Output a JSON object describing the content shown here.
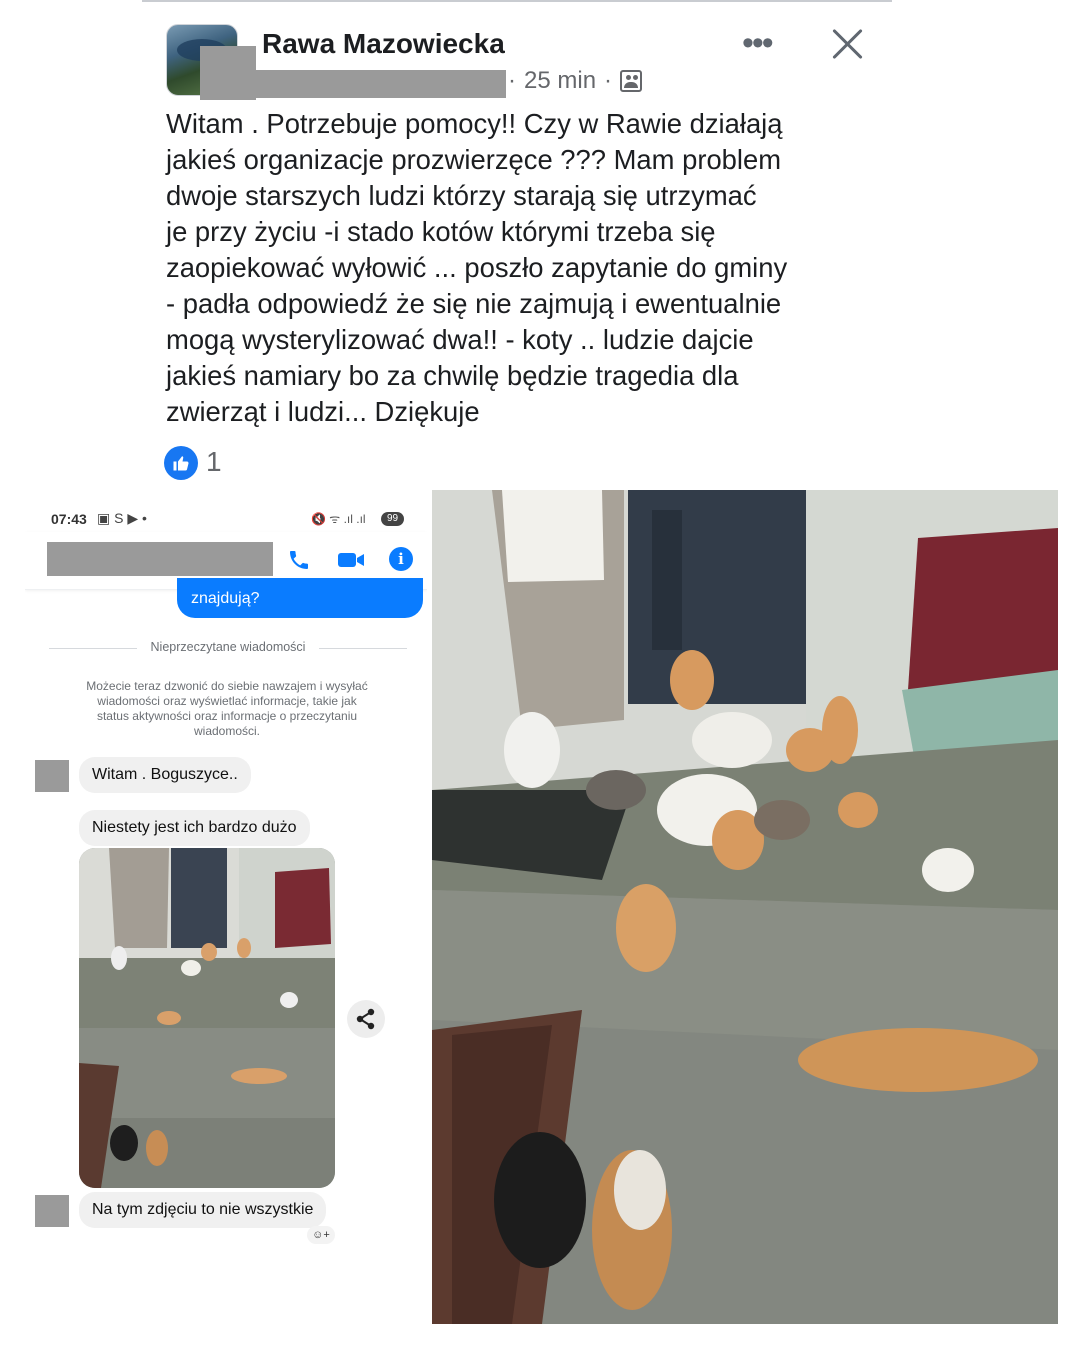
{
  "post": {
    "group_name": "Rawa Mazowiecka",
    "time": "25 min",
    "separator": "·",
    "text_lines": [
      "Witam . Potrzebuje pomocy!!  Czy w Rawie działają",
      "jakieś organizacje prozwierzęce  ??? Mam problem",
      "dwoje starszych ludzi  którzy starają się utrzymać",
      "je przy życiu -i stado kotów którymi trzeba się",
      "zaopiekować wyłowić ... poszło zapytanie do gminy",
      "- padła odpowiedź że się nie zajmują i ewentualnie",
      "mogą wysterylizować dwa!! - koty .. ludzie dajcie",
      "jakieś namiary  bo za chwilę będzie tragedia dla",
      "zwierząt i ludzi... Dziękuje"
    ],
    "like_count": "1",
    "icons": {
      "more": "more-horizontal-icon",
      "close": "close-icon",
      "audience": "group-audience-icon",
      "like": "thumbs-up-icon"
    },
    "accent_color": "#1877f2"
  },
  "messenger": {
    "status_time": "07:43",
    "status_icons": "▣ S ▶ •",
    "status_right": "🔇 ᯤ .ıl .ıl",
    "badge": "99",
    "sent_message_tail": "znajdują?",
    "divider_label": "Nieprzeczytane wiadomości",
    "notice": "Możecie teraz dzwonić do siebie nawzajem i wysyłać wiadomości oraz wyświetlać informacje, takie jak status aktywności oraz informacje o przeczytaniu wiadomości.",
    "messages": [
      "Witam . Boguszyce..",
      "Niestety jest ich bardzo dużo",
      "Na tym zdjęciu to nie wszystkie"
    ],
    "icons": {
      "call": "phone-icon",
      "video": "video-camera-icon",
      "info": "info-icon",
      "share": "share-icon",
      "reaction": "add-reaction-icon"
    },
    "accent_color": "#0a7cff"
  }
}
